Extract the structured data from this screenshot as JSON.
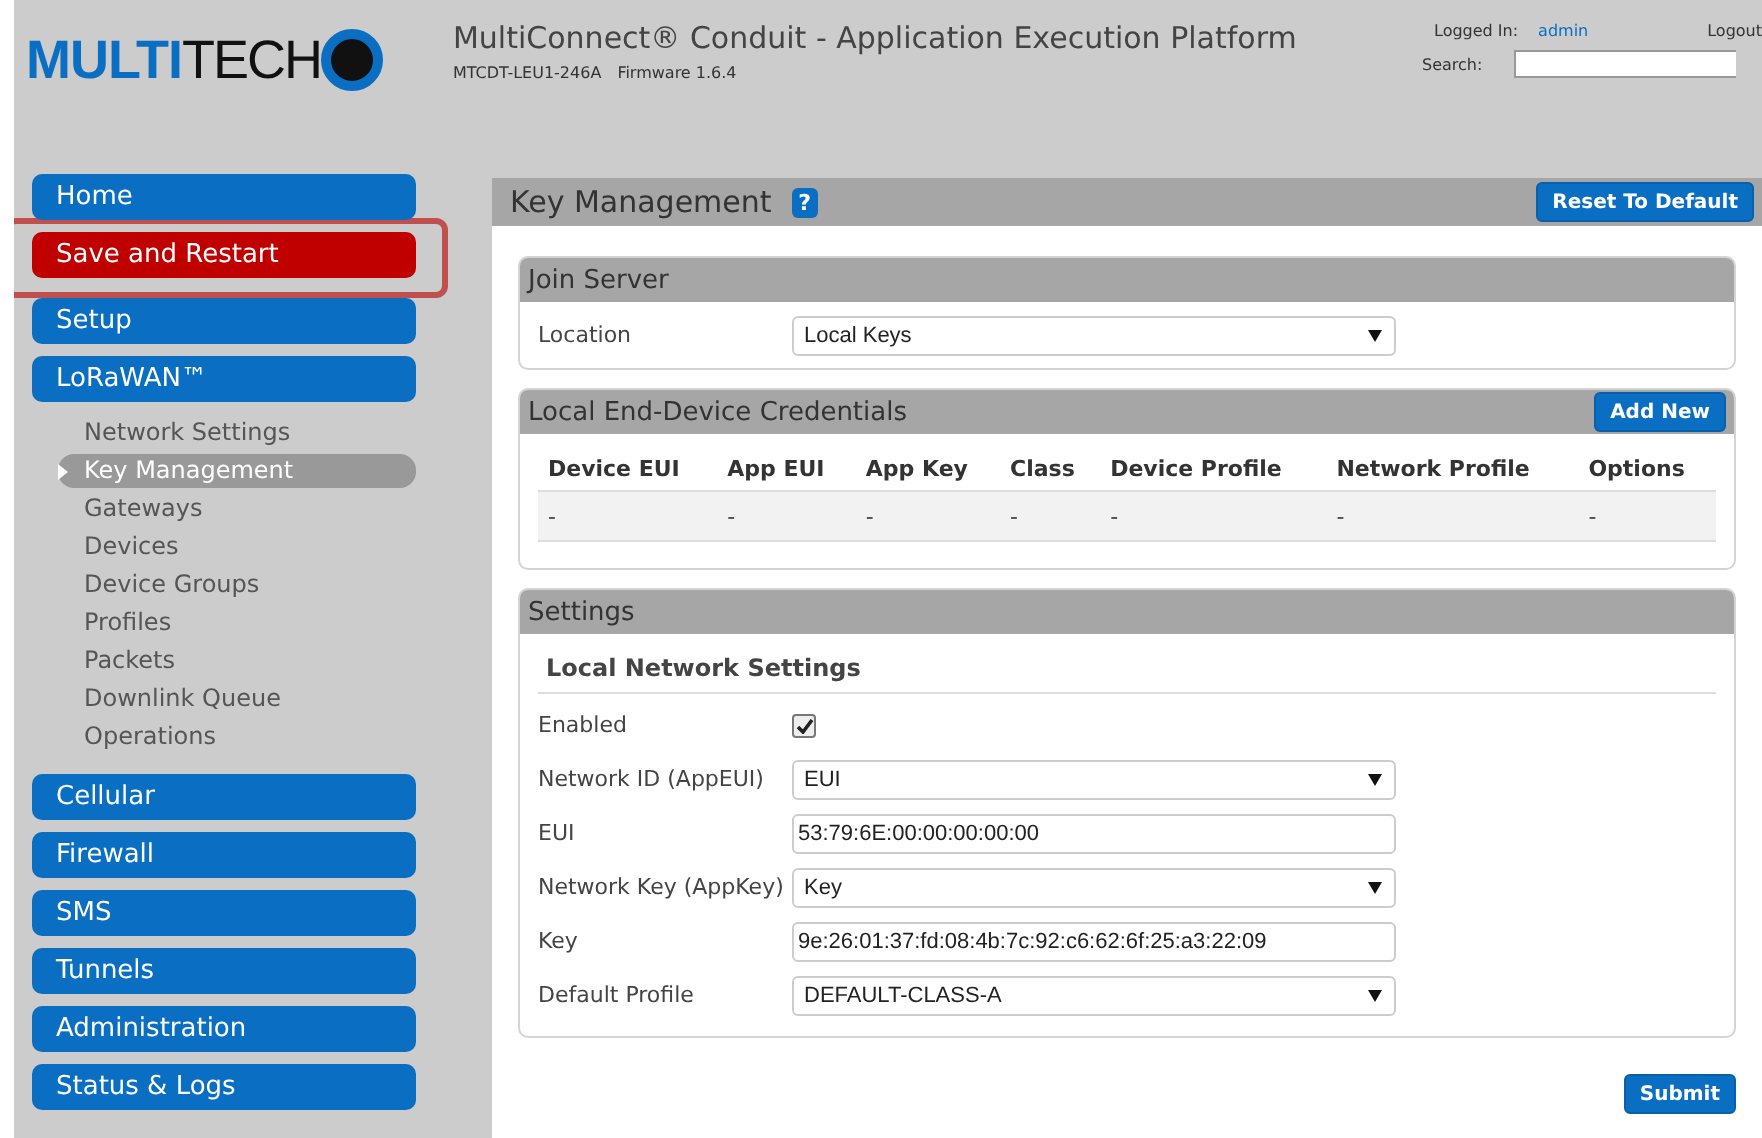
{
  "header": {
    "logo": {
      "bold": "MULTI",
      "light": "TECH"
    },
    "title": "MultiConnect® Conduit - Application Execution Platform",
    "model": "MTCDT-LEU1-246A",
    "firmware": "Firmware 1.6.4",
    "logged_in_label": "Logged In:",
    "user": "admin",
    "logout": "Logout",
    "search_label": "Search:"
  },
  "sidebar": {
    "items": [
      {
        "label": "Home",
        "kind": "section",
        "outlined": false
      },
      {
        "label": "Save and Restart",
        "kind": "action",
        "outlined": true
      },
      {
        "label": "Setup",
        "kind": "section",
        "outlined": false
      },
      {
        "label": "LoRaWAN™",
        "kind": "section",
        "outlined": false
      },
      {
        "label": "Network Settings",
        "kind": "sub",
        "selected": false
      },
      {
        "label": "Key Management",
        "kind": "sub",
        "selected": true
      },
      {
        "label": "Gateways",
        "kind": "sub",
        "selected": false
      },
      {
        "label": "Devices",
        "kind": "sub",
        "selected": false
      },
      {
        "label": "Device Groups",
        "kind": "sub",
        "selected": false
      },
      {
        "label": "Profiles",
        "kind": "sub",
        "selected": false
      },
      {
        "label": "Packets",
        "kind": "sub",
        "selected": false
      },
      {
        "label": "Downlink Queue",
        "kind": "sub",
        "selected": false
      },
      {
        "label": "Operations",
        "kind": "sub",
        "selected": false
      },
      {
        "label": "Cellular",
        "kind": "section",
        "outlined": false
      },
      {
        "label": "Firewall",
        "kind": "section",
        "outlined": false
      },
      {
        "label": "SMS",
        "kind": "section",
        "outlined": false
      },
      {
        "label": "Tunnels",
        "kind": "section",
        "outlined": false
      },
      {
        "label": "Administration",
        "kind": "section",
        "outlined": false
      },
      {
        "label": "Status & Logs",
        "kind": "section",
        "outlined": false
      }
    ]
  },
  "main": {
    "title": "Key Management",
    "help": "?",
    "reset_button": "Reset To Default",
    "join_server": {
      "title": "Join Server",
      "fields": [
        {
          "label": "Location",
          "kind": "select",
          "value": "Local Keys"
        }
      ]
    },
    "credentials": {
      "title": "Local End-Device Credentials",
      "add_button": "Add New",
      "table": {
        "columns": [
          "Device EUI",
          "App EUI",
          "App Key",
          "Class",
          "Device Profile",
          "Network Profile",
          "Options"
        ],
        "rows": [
          [
            "-",
            "-",
            "-",
            "-",
            "-",
            "-",
            "-"
          ]
        ]
      }
    },
    "settings": {
      "title": "Settings",
      "subtitle": "Local Network Settings",
      "fields": [
        {
          "label": "Enabled",
          "kind": "checkbox",
          "checked": true
        },
        {
          "label": "Network ID (AppEUI)",
          "kind": "select",
          "value": "EUI"
        },
        {
          "label": "EUI",
          "kind": "text",
          "value": "53:79:6E:00:00:00:00:00"
        },
        {
          "label": "Network Key (AppKey)",
          "kind": "select",
          "value": "Key"
        },
        {
          "label": "Key",
          "kind": "text",
          "value": "9e:26:01:37:fd:08:4b:7c:92:c6:62:6f:25:a3:22:09"
        },
        {
          "label": "Default Profile",
          "kind": "select",
          "value": "DEFAULT-CLASS-A"
        }
      ]
    },
    "submit_button": "Submit"
  }
}
